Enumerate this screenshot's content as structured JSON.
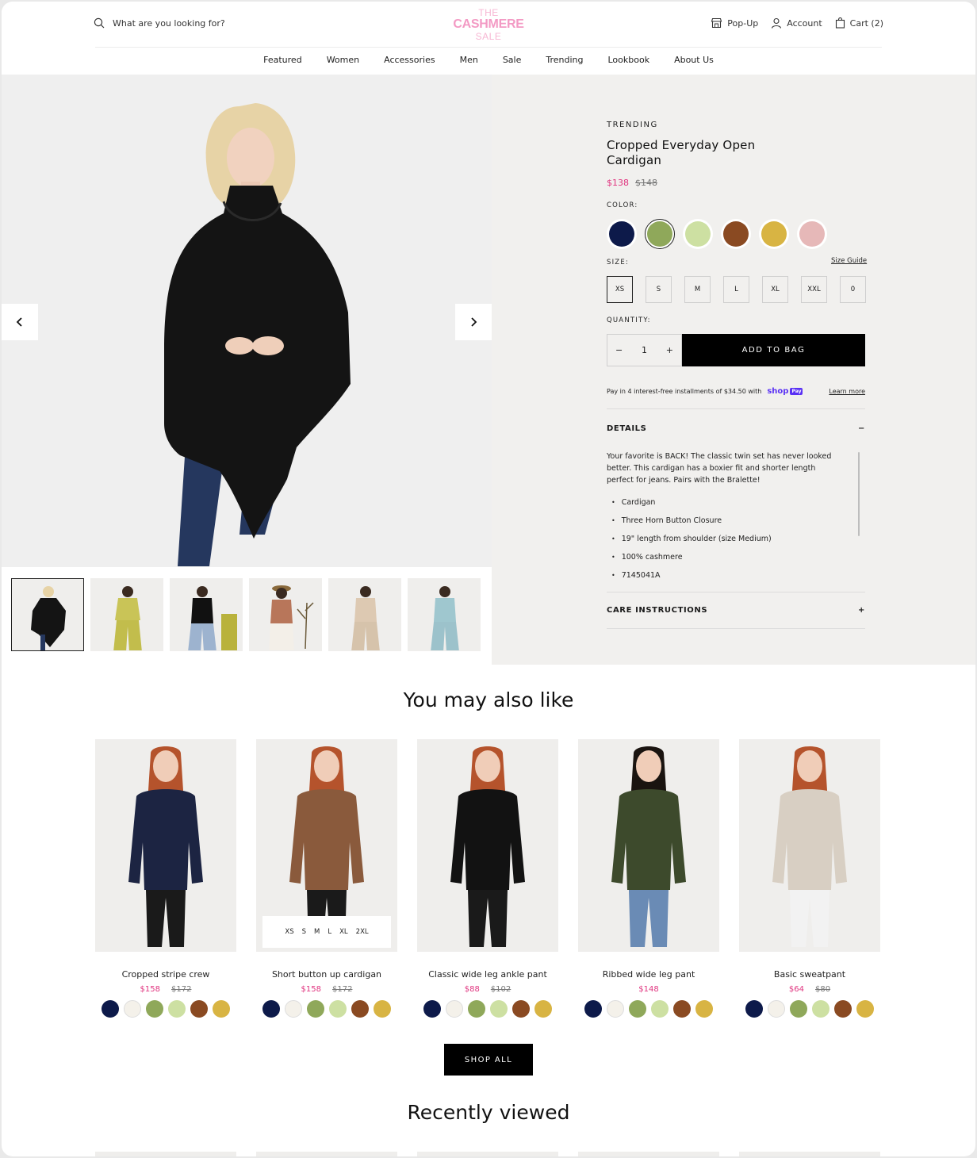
{
  "header": {
    "search_placeholder": "What are you looking for?",
    "logo": [
      "THE",
      "CASHMERE",
      "SALE"
    ],
    "popup_label": "Pop-Up",
    "account_label": "Account",
    "cart_label": "Cart (2)"
  },
  "nav": [
    "Featured",
    "Women",
    "Accessories",
    "Men",
    "Sale",
    "Trending",
    "Lookbook",
    "About Us"
  ],
  "product": {
    "eyebrow": "TRENDING",
    "title": "Cropped Everyday Open Cardigan",
    "sale_price": "$138",
    "original_price": "$148",
    "color_label": "COLOR:",
    "colors": [
      "#0d1a4a",
      "#8fa85a",
      "#cde0a2",
      "#8a4a22",
      "#d8b443",
      "#e6b8b8"
    ],
    "selected_color_index": 1,
    "size_label": "SIZE:",
    "size_guide": "Size Guide",
    "sizes": [
      "XS",
      "S",
      "M",
      "L",
      "XL",
      "XXL",
      "0"
    ],
    "selected_size": "XS",
    "quantity_label": "QUANTITY:",
    "quantity": "1",
    "minus": "−",
    "plus": "+",
    "add_to_bag": "ADD TO BAG",
    "installments": "Pay in 4 interest-free installments of $34.50 with",
    "shop_pay": "shop",
    "pay_badge": "Pay",
    "learn_more": "Learn more",
    "details_heading": "DETAILS",
    "details_toggle": "−",
    "details_text": "Your favorite is BACK! The classic twin set has never looked better. This cardigan has a boxier fit and shorter length perfect for jeans. Pairs with the Bralette!",
    "details_bullets": [
      "Cardigan",
      "Three Horn Button Closure",
      "19\" length from shoulder (size Medium)",
      "100% cashmere",
      "7145041A"
    ],
    "care_heading": "CARE INSTRUCTIONS",
    "care_toggle": "+"
  },
  "gallery": {
    "thumb_count": 6,
    "active_index": 0
  },
  "recommendations": {
    "heading": "You may also like",
    "swatch_colors": [
      "#0d1a4a",
      "#f4f1ea",
      "#8fa85a",
      "#cde0a2",
      "#8a4a22",
      "#d8b443"
    ],
    "size_overlay": [
      "XS",
      "S",
      "M",
      "L",
      "XL",
      "2XL"
    ],
    "items": [
      {
        "name": "Cropped stripe crew",
        "sale": "$158",
        "orig": "$172",
        "garment": "#1c2442"
      },
      {
        "name": "Short button up cardigan",
        "sale": "$158",
        "orig": "$172",
        "garment": "#8a5a3c"
      },
      {
        "name": "Classic wide leg ankle pant",
        "sale": "$88",
        "orig": "$102",
        "garment": "#121212"
      },
      {
        "name": "Ribbed wide leg pant",
        "sale": "$148",
        "orig": "",
        "garment": "#3d4a2c"
      },
      {
        "name": "Basic sweatpant",
        "sale": "$64",
        "orig": "$80",
        "garment": "#d8cfc3"
      }
    ],
    "shop_all": "SHOP ALL",
    "recent_heading": "Recently viewed"
  }
}
